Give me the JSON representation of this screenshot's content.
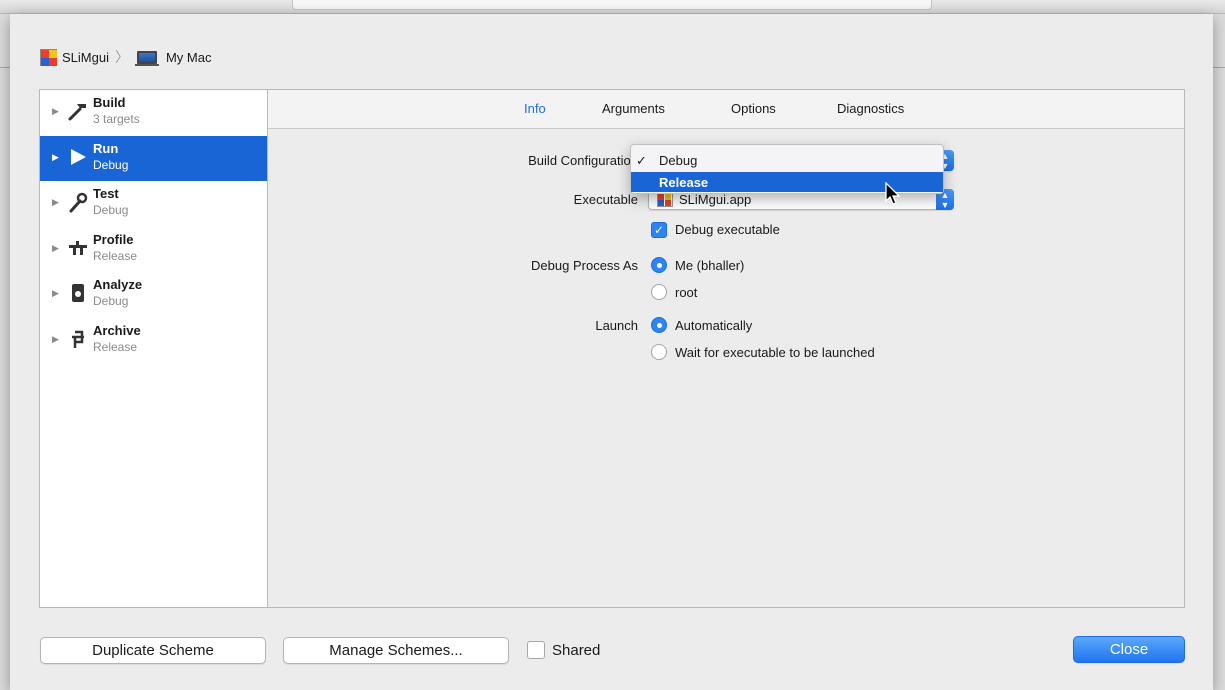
{
  "breadcrumb": {
    "scheme": "SLiMgui",
    "separator": "〉",
    "destination": "My Mac"
  },
  "sidebar": {
    "items": [
      {
        "title": "Build",
        "subtitle": "3 targets",
        "icon": "hammer-icon",
        "selected": false
      },
      {
        "title": "Run",
        "subtitle": "Debug",
        "icon": "play-icon",
        "selected": true
      },
      {
        "title": "Test",
        "subtitle": "Debug",
        "icon": "wrench-icon",
        "selected": false
      },
      {
        "title": "Profile",
        "subtitle": "Release",
        "icon": "gauge-icon",
        "selected": false
      },
      {
        "title": "Analyze",
        "subtitle": "Debug",
        "icon": "analyze-icon",
        "selected": false
      },
      {
        "title": "Archive",
        "subtitle": "Release",
        "icon": "archive-icon",
        "selected": false
      }
    ]
  },
  "tabs": [
    {
      "label": "Info",
      "active": true
    },
    {
      "label": "Arguments",
      "active": false
    },
    {
      "label": "Options",
      "active": false
    },
    {
      "label": "Diagnostics",
      "active": false
    }
  ],
  "info": {
    "build_configuration_label": "Build Configuration",
    "build_configuration_options": [
      {
        "label": "Debug",
        "checked": true,
        "highlighted": false
      },
      {
        "label": "Release",
        "checked": false,
        "highlighted": true
      }
    ],
    "executable_label": "Executable",
    "executable_value": "SLiMgui.app",
    "debug_executable_label": "Debug executable",
    "debug_executable_checked": true,
    "debug_process_as_label": "Debug Process As",
    "debug_process_as_options": [
      {
        "label": "Me (bhaller)",
        "selected": true
      },
      {
        "label": "root",
        "selected": false
      }
    ],
    "launch_label": "Launch",
    "launch_options": [
      {
        "label": "Automatically",
        "selected": true
      },
      {
        "label": "Wait for executable to be launched",
        "selected": false
      }
    ]
  },
  "footer": {
    "duplicate_label": "Duplicate Scheme",
    "manage_label": "Manage Schemes...",
    "shared_label": "Shared",
    "shared_checked": false,
    "close_label": "Close"
  },
  "colors": {
    "accent": "#1a65d6",
    "primary_button": "#2a7ff0"
  }
}
